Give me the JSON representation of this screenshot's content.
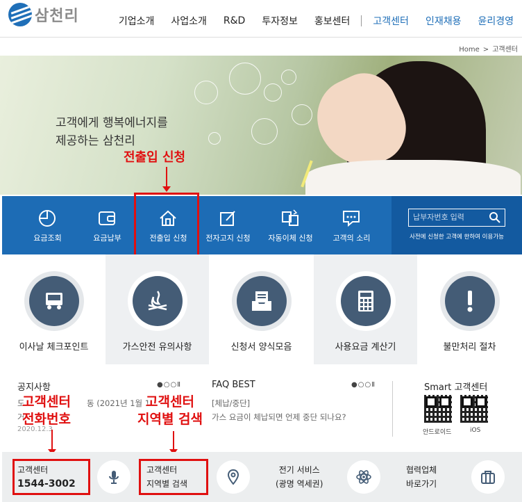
{
  "header": {
    "logo_text": "삼천리",
    "nav": [
      "기업소개",
      "사업소개",
      "R&D",
      "투자정보",
      "홍보센터",
      "고객센터",
      "인재채용",
      "윤리경영"
    ]
  },
  "breadcrumb": {
    "home": "Home",
    "separator": ">",
    "current": "고객센터"
  },
  "hero": {
    "line1": "고객에게 행복에너지를",
    "line2": "제공하는 삼천리"
  },
  "annotations": {
    "move_apply": "전출입 신청",
    "phone_line1": "고객센터",
    "phone_line2": "전화번호",
    "region_line1": "고객센터",
    "region_line2": "지역별 검색",
    "color": "#e01010"
  },
  "quickbar": {
    "items": [
      {
        "label": "요금조회",
        "icon": "pie-chart-icon"
      },
      {
        "label": "요금납부",
        "icon": "wallet-icon"
      },
      {
        "label": "전출입 신청",
        "icon": "house-icon"
      },
      {
        "label": "전자고지 신청",
        "icon": "edit-icon"
      },
      {
        "label": "자동이체 신청",
        "icon": "transfer-icon"
      },
      {
        "label": "고객의 소리",
        "icon": "chat-icon"
      }
    ],
    "search_placeholder": "납부자번호 입력",
    "search_note": "사전에 신청한 고객에 한하여 이용가능",
    "color": "#1d6cb5"
  },
  "shortcuts": [
    {
      "label": "이사날 체크포인트",
      "icon": "truck-icon"
    },
    {
      "label": "가스안전 유의사항",
      "icon": "flame-icon"
    },
    {
      "label": "신청서 양식모음",
      "icon": "document-tray-icon"
    },
    {
      "label": "사용요금 계산기",
      "icon": "calculator-icon"
    },
    {
      "label": "불만처리 절차",
      "icon": "exclamation-icon"
    }
  ],
  "notice": {
    "title": "공지사항",
    "dots": "●○○Ⅱ",
    "visible_fragments": [
      "도",
      "동 (2021년 1월 1",
      "거",
      "2020.12.3"
    ]
  },
  "faq": {
    "title": "FAQ BEST",
    "dots": "●○○Ⅱ",
    "category": "[체납/중단]",
    "question": "가스 요금이 체납되면 언제 중단 되나요?"
  },
  "smart": {
    "title": "Smart 고객센터",
    "android": "안드로이드",
    "ios": "iOS"
  },
  "bottombar": {
    "center_label": "고객센터",
    "phone": "1544-3002",
    "region_label1": "고객센터",
    "region_label2": "지역별 검색",
    "service_line1": "전기 서비스",
    "service_line2": "(광명 역세권)",
    "partner_line1": "협력업체",
    "partner_line2": "바로가기"
  }
}
